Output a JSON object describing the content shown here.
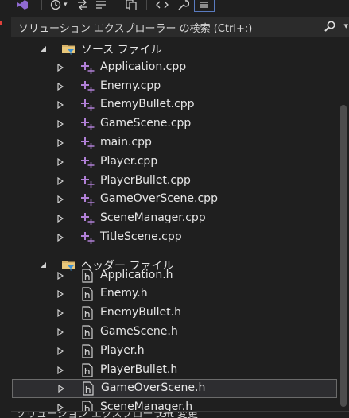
{
  "window": {
    "search_placeholder": "ソリューション エクスプローラー の検索 (Ctrl+:)"
  },
  "toolbar": {
    "icons": [
      "visual-studio-icon",
      "history-icon",
      "sync-icon",
      "copy-icon",
      "code-icon",
      "wrench-icon",
      "preview-icon"
    ]
  },
  "tree": {
    "source_folder": "ソース ファイル",
    "header_folder": "ヘッダー ファイル",
    "source_files": [
      "Application.cpp",
      "Enemy.cpp",
      "EnemyBullet.cpp",
      "GameScene.cpp",
      "main.cpp",
      "Player.cpp",
      "PlayerBullet.cpp",
      "GameOverScene.cpp",
      "SceneManager.cpp",
      "TitleScene.cpp"
    ],
    "header_files": [
      "Application.h",
      "Enemy.h",
      "EnemyBullet.h",
      "GameScene.h",
      "Player.h",
      "PlayerBullet.h",
      "GameOverScene.h",
      "SceneManager.h"
    ],
    "selected_item": "GameOverScene.h"
  },
  "bottom_tabs": [
    "ソリューション エクスプローラー",
    "Git 変更"
  ],
  "colors": {
    "background": "#1f1f1f",
    "cpp_icon": "#b180d7",
    "folder": "#d7b36a",
    "selection_border": "#6b6b6b"
  }
}
